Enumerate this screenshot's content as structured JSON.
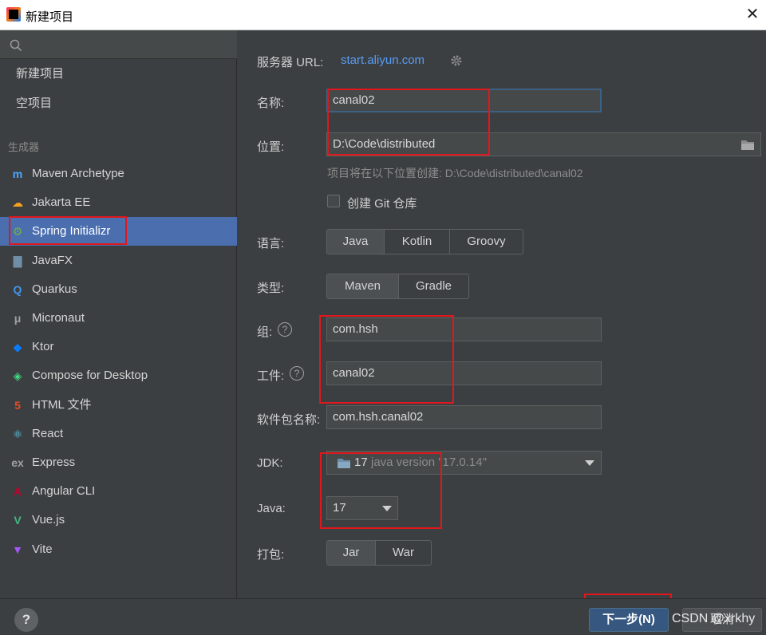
{
  "window": {
    "title": "新建项目",
    "close": "✕"
  },
  "sidebar": {
    "search_icon": "search-icon",
    "top_items": [
      {
        "label": "新建项目"
      },
      {
        "label": "空项目"
      }
    ],
    "section_label": "生成器",
    "generators": [
      {
        "label": "Maven Archetype",
        "icon": "m",
        "color": "#4aa8ff"
      },
      {
        "label": "Jakarta EE",
        "icon": "☁",
        "color": "#f6a21c"
      },
      {
        "label": "Spring Initializr",
        "icon": "⚙",
        "color": "#6db33f",
        "selected": true
      },
      {
        "label": "JavaFX",
        "icon": "▇",
        "color": "#6f8fa8"
      },
      {
        "label": "Quarkus",
        "icon": "Q",
        "color": "#4695eb"
      },
      {
        "label": "Micronaut",
        "icon": "μ",
        "color": "#a0a0a0"
      },
      {
        "label": "Ktor",
        "icon": "◆",
        "color": "#087cfa"
      },
      {
        "label": "Compose for Desktop",
        "icon": "◈",
        "color": "#3ddc84"
      },
      {
        "label": "HTML 文件",
        "icon": "5",
        "color": "#e34c26"
      },
      {
        "label": "React",
        "icon": "⚛",
        "color": "#61dafb"
      },
      {
        "label": "Express",
        "icon": "ex",
        "color": "#a0a0a0"
      },
      {
        "label": "Angular CLI",
        "icon": "A",
        "color": "#c3002f"
      },
      {
        "label": "Vue.js",
        "icon": "V",
        "color": "#41b883"
      },
      {
        "label": "Vite",
        "icon": "▼",
        "color": "#a855f7"
      }
    ]
  },
  "form": {
    "server_url_label": "服务器 URL:",
    "server_url": "start.aliyun.com",
    "name_label": "名称:",
    "name_value": "canal02",
    "location_label": "位置:",
    "location_value": "D:\\Code\\distributed",
    "location_hint": "项目将在以下位置创建: D:\\Code\\distributed\\canal02",
    "git_label": "创建 Git 仓库",
    "language_label": "语言:",
    "languages": [
      "Java",
      "Kotlin",
      "Groovy"
    ],
    "type_label": "类型:",
    "types": [
      "Maven",
      "Gradle"
    ],
    "group_label": "组:",
    "group_value": "com.hsh",
    "artifact_label": "工件:",
    "artifact_value": "canal02",
    "package_label": "软件包名称:",
    "package_value": "com.hsh.canal02",
    "jdk_label": "JDK:",
    "jdk_version": "17",
    "jdk_detail": "java version \"17.0.14\"",
    "java_label": "Java:",
    "java_value": "17",
    "packaging_label": "打包:",
    "packagings": [
      "Jar",
      "War"
    ]
  },
  "footer": {
    "help": "?",
    "next": "下一步(N)",
    "cancel": "取消"
  },
  "watermark": "CSDN @xrkhy"
}
